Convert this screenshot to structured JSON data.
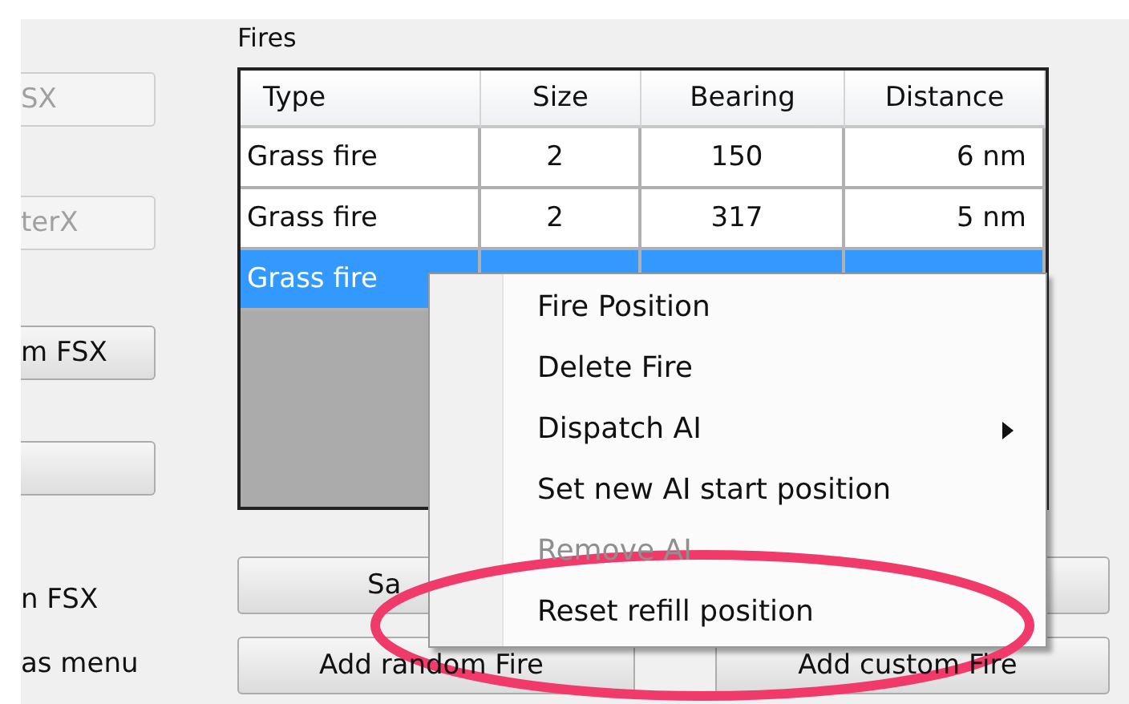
{
  "left_panel": {
    "buttons": [
      {
        "label": "SX",
        "disabled": true
      },
      {
        "label": "terX",
        "disabled": true
      },
      {
        "label": "m FSX",
        "disabled": false
      },
      {
        "disabled": false
      }
    ],
    "labels": [
      "n FSX",
      "as menu"
    ]
  },
  "fires": {
    "title": "Fires",
    "columns": [
      "Type",
      "Size",
      "Bearing",
      "Distance"
    ],
    "rows": [
      {
        "cells": [
          "Grass fire",
          "2",
          "150",
          "6 nm"
        ],
        "selected": false
      },
      {
        "cells": [
          "Grass fire",
          "2",
          "317",
          "5 nm"
        ],
        "selected": false
      },
      {
        "cells": [
          "Grass fire"
        ],
        "selected": true
      }
    ]
  },
  "buttons": [
    {
      "label": "Sa"
    }
  ],
  "add_buttons": [
    {
      "label": "Add random Fire"
    },
    {
      "label": "Add custom Fire"
    }
  ],
  "context_menu": {
    "items": [
      {
        "label": "Fire Position",
        "disabled": false,
        "submenu": false
      },
      {
        "label": "Delete Fire",
        "disabled": false,
        "submenu": false
      },
      {
        "label": "Dispatch AI",
        "disabled": false,
        "submenu": true
      },
      {
        "label": "Set new AI start position",
        "disabled": false,
        "submenu": false
      },
      {
        "label": "Remove AI",
        "disabled": true,
        "submenu": false
      },
      {
        "label": "Reset refill position",
        "disabled": false,
        "submenu": false
      }
    ]
  },
  "annotation": {
    "kind": "ellipse",
    "color": "#f03a6a"
  }
}
